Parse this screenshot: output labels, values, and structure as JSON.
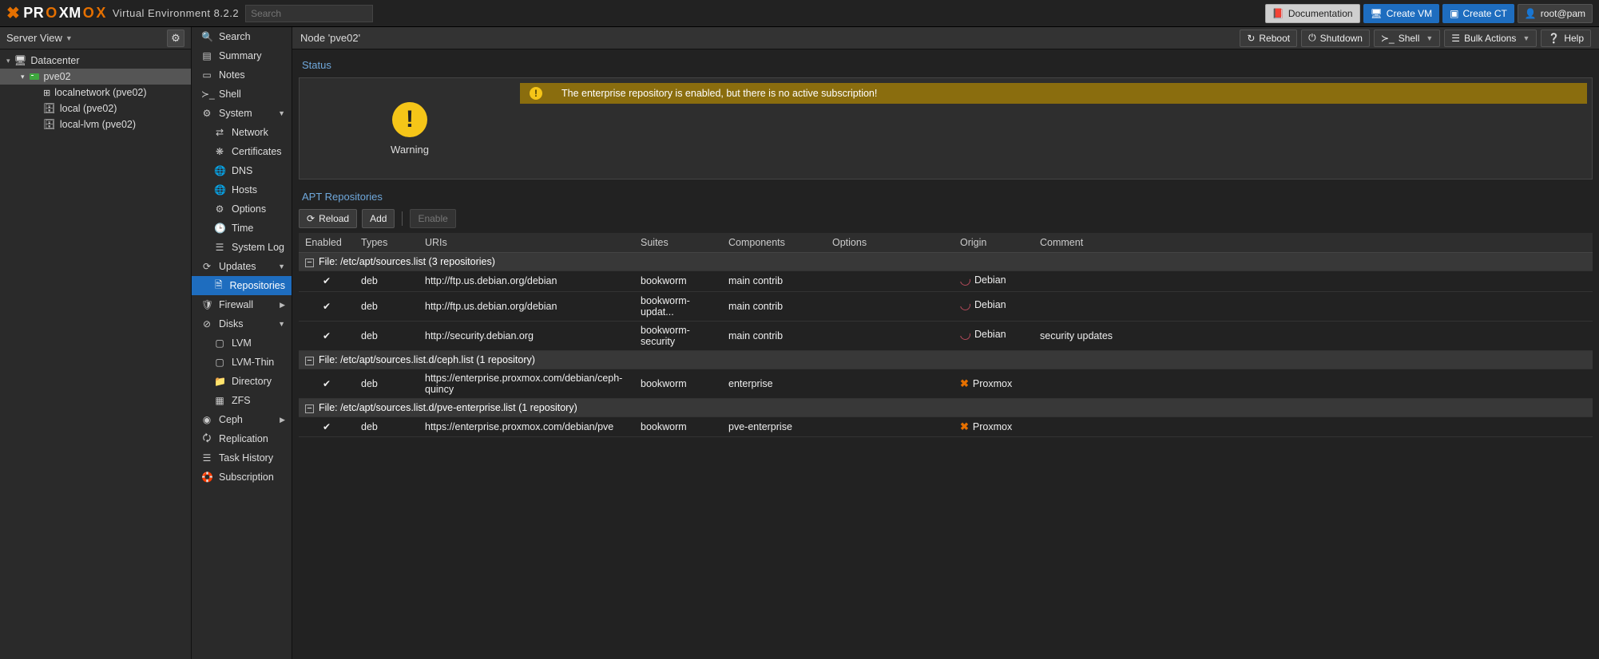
{
  "top": {
    "brand_pre": "PR",
    "brand_o1": "O",
    "brand_mid": "XM",
    "brand_o2": "O",
    "brand_x": "X",
    "product": "Virtual Environment 8.2.2",
    "search_placeholder": "Search",
    "doc": "Documentation",
    "create_vm": "Create VM",
    "create_ct": "Create CT",
    "user": "root@pam"
  },
  "tree": {
    "header": "Server View",
    "datacenter": "Datacenter",
    "node": "pve02",
    "items": [
      "localnetwork (pve02)",
      "local (pve02)",
      "local-lvm (pve02)"
    ]
  },
  "nav": {
    "search": "Search",
    "summary": "Summary",
    "notes": "Notes",
    "shell": "Shell",
    "system": "System",
    "network": "Network",
    "certificates": "Certificates",
    "dns": "DNS",
    "hosts": "Hosts",
    "options": "Options",
    "time": "Time",
    "syslog": "System Log",
    "updates": "Updates",
    "repositories": "Repositories",
    "firewall": "Firewall",
    "disks": "Disks",
    "lvm": "LVM",
    "lvmthin": "LVM-Thin",
    "directory": "Directory",
    "zfs": "ZFS",
    "ceph": "Ceph",
    "replication": "Replication",
    "taskhistory": "Task History",
    "subscription": "Subscription"
  },
  "header": {
    "title": "Node 'pve02'",
    "reboot": "Reboot",
    "shutdown": "Shutdown",
    "shell": "Shell",
    "bulk": "Bulk Actions",
    "help": "Help"
  },
  "status": {
    "title": "Status",
    "warning": "Warning",
    "msg": "The enterprise repository is enabled, but there is no active subscription!"
  },
  "apt": {
    "title": "APT Repositories",
    "reload": "Reload",
    "add": "Add",
    "enable": "Enable",
    "cols": {
      "enabled": "Enabled",
      "types": "Types",
      "uris": "URIs",
      "suites": "Suites",
      "components": "Components",
      "options": "Options",
      "origin": "Origin",
      "comment": "Comment"
    },
    "groups": [
      {
        "label": "File: /etc/apt/sources.list (3 repositories)",
        "rows": [
          {
            "enabled": true,
            "type": "deb",
            "uri": "http://ftp.us.debian.org/debian",
            "suite": "bookworm",
            "comp": "main contrib",
            "opt": "",
            "origin": "Debian",
            "origin_kind": "debian",
            "comment": ""
          },
          {
            "enabled": true,
            "type": "deb",
            "uri": "http://ftp.us.debian.org/debian",
            "suite": "bookworm-updat...",
            "comp": "main contrib",
            "opt": "",
            "origin": "Debian",
            "origin_kind": "debian",
            "comment": ""
          },
          {
            "enabled": true,
            "type": "deb",
            "uri": "http://security.debian.org",
            "suite": "bookworm-security",
            "comp": "main contrib",
            "opt": "",
            "origin": "Debian",
            "origin_kind": "debian",
            "comment": "security updates"
          }
        ]
      },
      {
        "label": "File: /etc/apt/sources.list.d/ceph.list (1 repository)",
        "rows": [
          {
            "enabled": true,
            "type": "deb",
            "uri": "https://enterprise.proxmox.com/debian/ceph-quincy",
            "suite": "bookworm",
            "comp": "enterprise",
            "opt": "",
            "origin": "Proxmox",
            "origin_kind": "proxmox",
            "comment": ""
          }
        ]
      },
      {
        "label": "File: /etc/apt/sources.list.d/pve-enterprise.list (1 repository)",
        "rows": [
          {
            "enabled": true,
            "type": "deb",
            "uri": "https://enterprise.proxmox.com/debian/pve",
            "suite": "bookworm",
            "comp": "pve-enterprise",
            "opt": "",
            "origin": "Proxmox",
            "origin_kind": "proxmox",
            "comment": ""
          }
        ]
      }
    ]
  }
}
